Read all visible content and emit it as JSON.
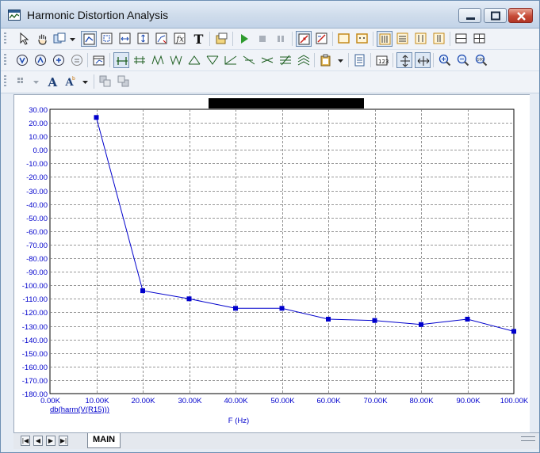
{
  "window": {
    "title": "Harmonic Distortion Analysis"
  },
  "tab": {
    "label": "MAIN"
  },
  "nav": {
    "first": "|◀",
    "prev": "◀",
    "next": "▶",
    "last": "▶|"
  },
  "chart_data": {
    "type": "line",
    "title": "",
    "xlabel": "F (Hz)",
    "ylabel": "",
    "xlim": [
      0,
      100000
    ],
    "ylim": [
      -180,
      30
    ],
    "x_ticks": [
      "0.00K",
      "10.00K",
      "20.00K",
      "30.00K",
      "40.00K",
      "50.00K",
      "60.00K",
      "70.00K",
      "80.00K",
      "90.00K",
      "100.00K"
    ],
    "y_ticks": [
      "30.00",
      "20.00",
      "10.00",
      "0.00",
      "-10.00",
      "-20.00",
      "-30.00",
      "-40.00",
      "-50.00",
      "-60.00",
      "-70.00",
      "-80.00",
      "-90.00",
      "-100.00",
      "-110.00",
      "-120.00",
      "-130.00",
      "-140.00",
      "-150.00",
      "-160.00",
      "-170.00",
      "-180.00"
    ],
    "grid": true,
    "series": [
      {
        "name": "db(harm(V(R15)))",
        "color": "#0000cc",
        "x": [
          10000,
          20000,
          30000,
          40000,
          50000,
          60000,
          70000,
          80000,
          90000,
          100000
        ],
        "y": [
          24,
          -104,
          -110,
          -117,
          -117,
          -125,
          -126,
          -129,
          -125,
          -134
        ]
      }
    ]
  }
}
